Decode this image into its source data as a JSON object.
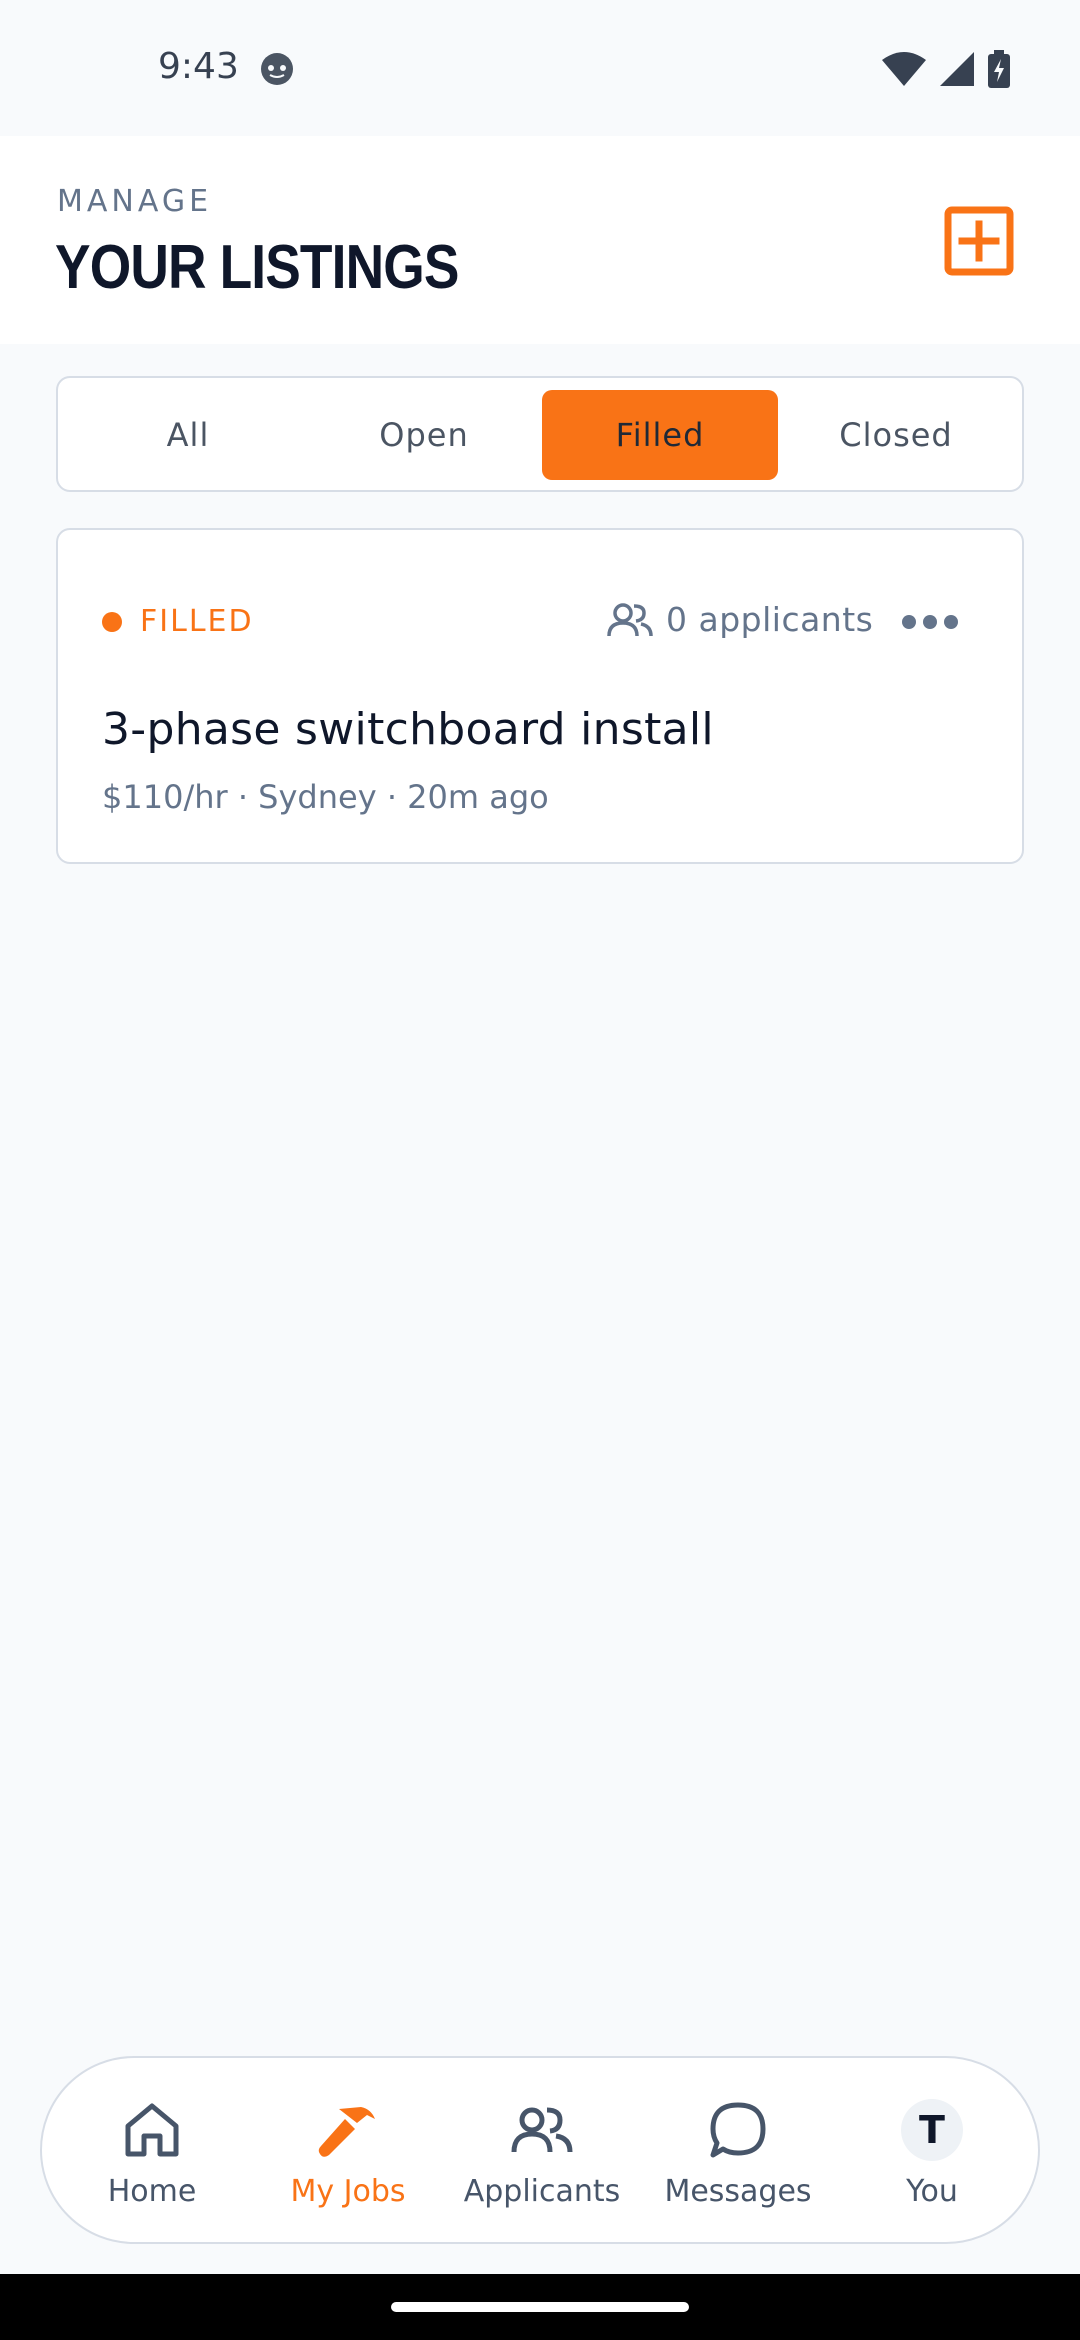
{
  "status_bar": {
    "time": "9:43",
    "icons": [
      "face-icon",
      "wifi-icon",
      "signal-icon",
      "battery-charging-icon"
    ]
  },
  "header": {
    "eyebrow": "MANAGE",
    "title": "YOUR LISTINGS",
    "add_icon": "plus-square-icon"
  },
  "filters": {
    "tabs": [
      {
        "label": "All"
      },
      {
        "label": "Open"
      },
      {
        "label": "Filled"
      },
      {
        "label": "Closed"
      }
    ],
    "active": "Filled"
  },
  "listings": [
    {
      "status": "FILLED",
      "applicants": "0 applicants",
      "title": "3-phase switchboard install",
      "meta": "$110/hr · Sydney · 20m ago"
    }
  ],
  "bottom_nav": {
    "items": [
      {
        "label": "Home",
        "icon": "home-icon"
      },
      {
        "label": "My Jobs",
        "icon": "hammer-icon"
      },
      {
        "label": "Applicants",
        "icon": "users-icon"
      },
      {
        "label": "Messages",
        "icon": "chat-bubble-icon"
      },
      {
        "label": "You",
        "icon": "avatar",
        "initial": "T"
      }
    ],
    "active": "My Jobs"
  },
  "colors": {
    "accent": "#f97316",
    "text_dark": "#0f172a",
    "text_muted": "#64748b",
    "border": "#d7dde6",
    "background": "#f8fafc"
  }
}
